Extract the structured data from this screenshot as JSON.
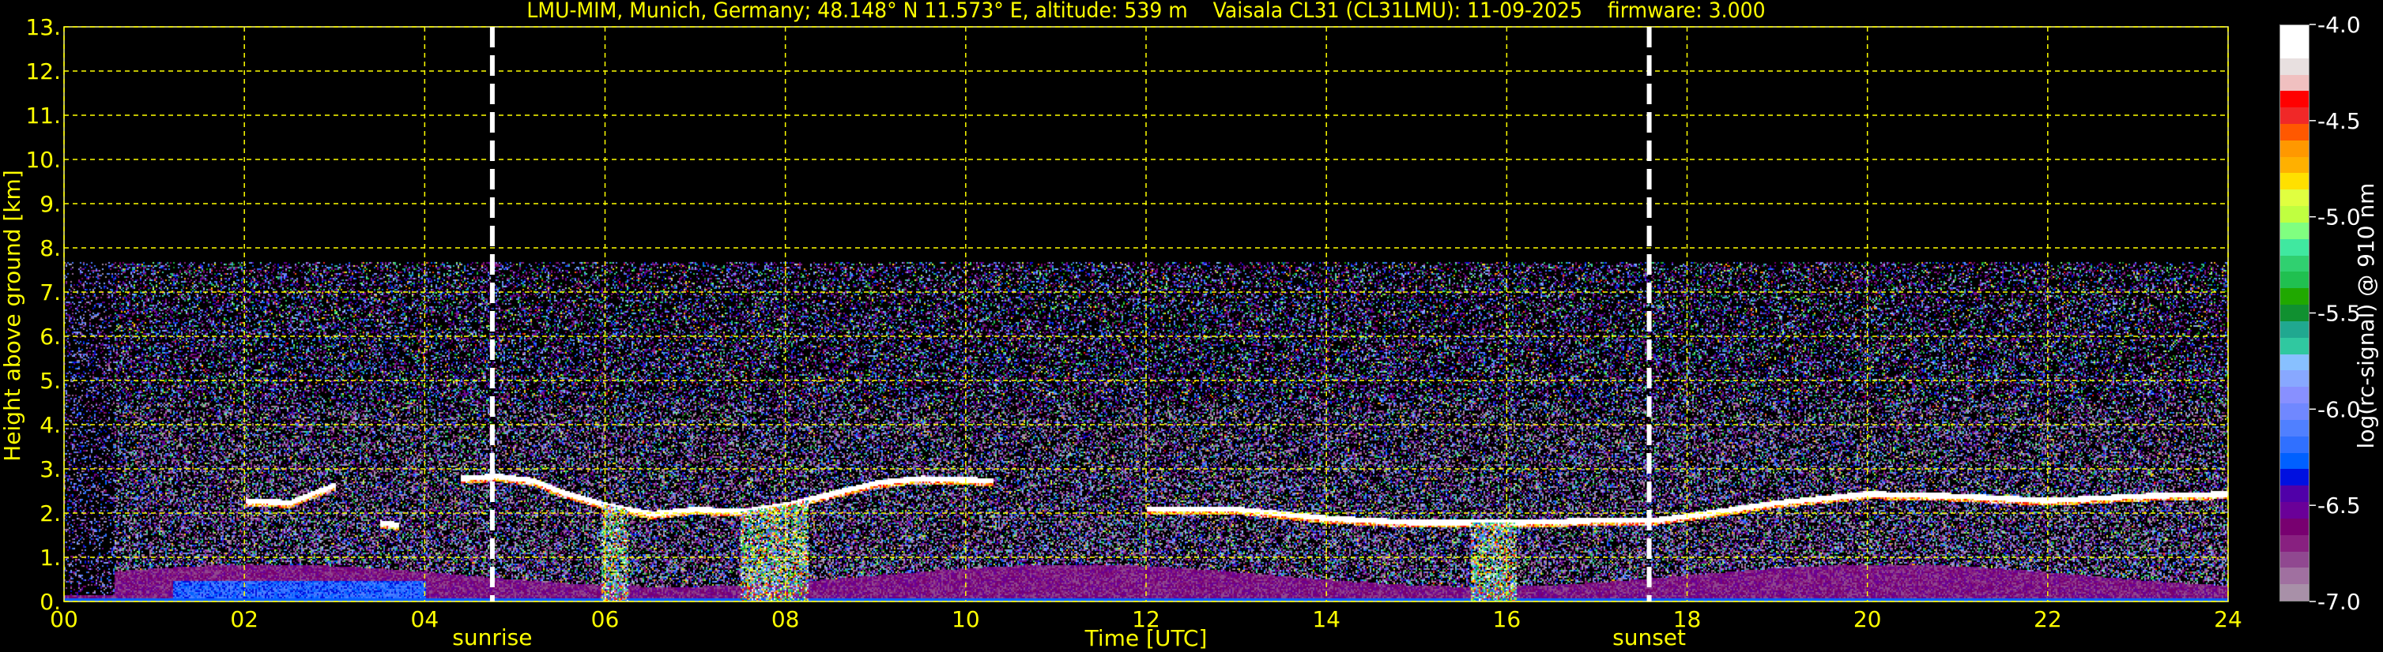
{
  "chart_data": {
    "type": "heatmap",
    "title": "LMU-MIM, Munich, Germany; 48.148° N 11.573° E, altitude: 539 m    Vaisala CL31 (CL31LMU): 11-09-2025    firmware: 3.000",
    "xlabel": "Time [UTC]",
    "ylabel": "Height above ground [km]",
    "xlim": [
      0,
      24
    ],
    "ylim": [
      0,
      13
    ],
    "xticks": [
      "00",
      "02",
      "04",
      "06",
      "08",
      "10",
      "12",
      "14",
      "16",
      "18",
      "20",
      "22",
      "24"
    ],
    "yticks": [
      "0.",
      "1.",
      "2.",
      "3.",
      "4.",
      "5.",
      "6.",
      "7.",
      "8.",
      "9.",
      "10.",
      "11.",
      "12.",
      "13."
    ],
    "grid": true,
    "annotations": [
      {
        "label": "sunrise",
        "time": 4.75
      },
      {
        "label": "sunset",
        "time": 17.58
      }
    ],
    "signal_top_km": 7.7,
    "cloud_layer": [
      [
        [
          2.0,
          2.3
        ],
        [
          2.5,
          2.25
        ],
        [
          2.8,
          2.5
        ],
        [
          3.0,
          2.65
        ]
      ],
      [
        [
          3.5,
          1.8
        ],
        [
          3.7,
          1.75
        ]
      ],
      [
        [
          4.4,
          2.8
        ],
        [
          4.8,
          2.85
        ],
        [
          5.2,
          2.75
        ],
        [
          5.5,
          2.5
        ],
        [
          6.0,
          2.2
        ],
        [
          6.5,
          2.0
        ],
        [
          7.0,
          2.1
        ],
        [
          7.5,
          2.05
        ],
        [
          8.0,
          2.2
        ],
        [
          8.5,
          2.45
        ],
        [
          9.0,
          2.7
        ],
        [
          9.5,
          2.8
        ],
        [
          10.3,
          2.75
        ]
      ],
      [
        [
          12.0,
          2.1
        ],
        [
          13.0,
          2.1
        ],
        [
          13.5,
          2.0
        ],
        [
          14.0,
          1.9
        ],
        [
          14.5,
          1.85
        ],
        [
          15.0,
          1.8
        ],
        [
          16.0,
          1.8
        ],
        [
          17.0,
          1.85
        ],
        [
          17.6,
          1.85
        ],
        [
          18.0,
          1.95
        ],
        [
          18.5,
          2.1
        ],
        [
          19.0,
          2.25
        ],
        [
          19.5,
          2.35
        ],
        [
          20.0,
          2.45
        ],
        [
          21.0,
          2.4
        ],
        [
          21.5,
          2.35
        ],
        [
          22.0,
          2.3
        ],
        [
          23.0,
          2.4
        ],
        [
          24.0,
          2.45
        ]
      ]
    ],
    "precipitation_fallstreaks": [
      [
        5.95,
        6.25
      ],
      [
        7.5,
        8.25
      ],
      [
        15.6,
        16.1
      ]
    ],
    "colorbar": {
      "label": "log(rc-signal) @ 910 nm",
      "range": [
        -7.0,
        -4.0
      ],
      "ticks": [
        "-4.0",
        "-4.5",
        "-5.0",
        "-5.5",
        "-6.0",
        "-6.5",
        "-7.0"
      ],
      "colors": [
        "#a890a8",
        "#a070a0",
        "#904890",
        "#882080",
        "#780070",
        "#6a0098",
        "#5000a8",
        "#0010e0",
        "#0060ff",
        "#3070ff",
        "#5080ff",
        "#7088ff",
        "#8890ff",
        "#88a8ff",
        "#88c0ff",
        "#30c8a0",
        "#20a890",
        "#109030",
        "#20a800",
        "#20c050",
        "#30d070",
        "#40e8a0",
        "#80ff80",
        "#c0ff40",
        "#e0ff40",
        "#ffe000",
        "#ffb000",
        "#ff9800",
        "#ff5800",
        "#f02828",
        "#ff0000",
        "#f0c0c0",
        "#e8e0e0",
        "#ffffff",
        "#ffffff"
      ]
    }
  }
}
